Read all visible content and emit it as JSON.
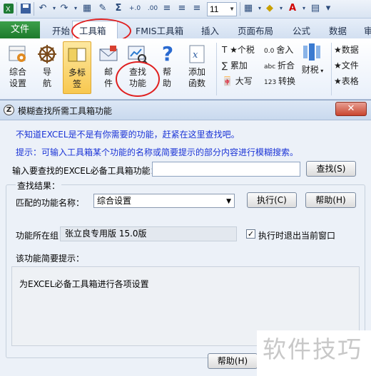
{
  "qat": {
    "font_size": "11"
  },
  "ribbon_tabs": [
    "文件",
    "开始",
    "工具箱",
    "FMIS工具箱",
    "插入",
    "页面布局",
    "公式",
    "数据",
    "审"
  ],
  "ribbon": {
    "settings": "综合\n设置",
    "navigate": "导\n航",
    "multi_tab": "多标\n签",
    "mail": "邮\n件",
    "find_function": "查找\n功能",
    "help": "帮\n助",
    "add_function": "添加\n函数",
    "tax": "个税",
    "round": "舍入",
    "cumulative": "累加",
    "fold": "折合",
    "uppercase": "大写",
    "convert": "转换",
    "finance": "财税",
    "data_label": "★数据",
    "file_label": "★文件",
    "table_label": "★表格"
  },
  "dialog": {
    "title": "模糊查找所需工具箱功能",
    "close_glyph": "✕",
    "intro": "不知道EXCEL是不是有你需要的功能，赶紧在这里查找吧。",
    "hint": "提示：可输入工具箱某个功能的名称或简要提示的部分内容进行模糊搜索。",
    "search_label": "输入要查找的EXCEL必备工具箱功能：",
    "search_value": "",
    "search_button": "查找(S)",
    "results_label": "查找结果：",
    "match_label": "匹配的功能名称：",
    "match_value": "综合设置",
    "execute_button": "执行(C)",
    "help_button": "帮助(H)",
    "group_label": "功能所在组：",
    "group_value": "张立良专用版 15.0版",
    "exit_checkbox_label": "执行时退出当前窗口",
    "exit_checked": true,
    "desc_label": "该功能简要提示：",
    "desc_text": "为EXCEL必备工具箱进行各项设置",
    "bottom_help_button": "帮助(H)"
  },
  "watermark": "软件技巧",
  "colors": {
    "file_tab": "#1d7a2c",
    "hint_text": "#1a33d6",
    "annotation_circle": "#e02020"
  }
}
